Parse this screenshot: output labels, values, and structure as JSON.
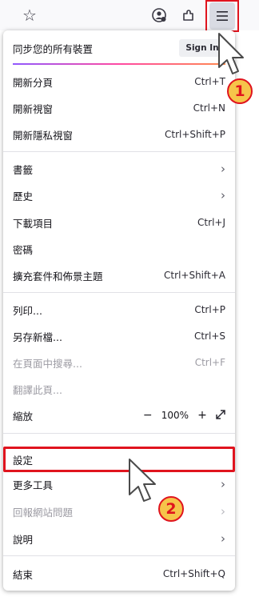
{
  "toolbar": {
    "icons": [
      "star-icon",
      "account-icon",
      "extensions-icon",
      "hamburger-menu-icon"
    ]
  },
  "menu": {
    "sync_label": "同步您的所有裝置",
    "sign_in": "Sign In",
    "new_tab": "開新分頁",
    "new_tab_sc": "Ctrl+T",
    "new_window": "開新視窗",
    "new_window_sc": "Ctrl+N",
    "new_private": "開新隱私視窗",
    "new_private_sc": "Ctrl+Shift+P",
    "bookmarks": "書籤",
    "history": "歷史",
    "downloads": "下載項目",
    "downloads_sc": "Ctrl+J",
    "passwords": "密碼",
    "addons": "擴充套件和佈景主題",
    "addons_sc": "Ctrl+Shift+A",
    "print": "列印...",
    "print_sc": "Ctrl+P",
    "save_as": "另存新檔...",
    "save_as_sc": "Ctrl+S",
    "find": "在頁面中搜尋...",
    "find_sc": "Ctrl+F",
    "translate": "翻譯此頁...",
    "zoom": "縮放",
    "zoom_minus": "−",
    "zoom_value": "100%",
    "zoom_plus": "+",
    "settings": "設定",
    "more_tools": "更多工具",
    "report_site": "回報網站問題",
    "help": "說明",
    "quit": "結束",
    "quit_sc": "Ctrl+Shift+Q"
  },
  "annotations": {
    "step1": "1",
    "step2": "2",
    "highlight_color": "#e0141e",
    "badge_color": "#f6c44a"
  }
}
